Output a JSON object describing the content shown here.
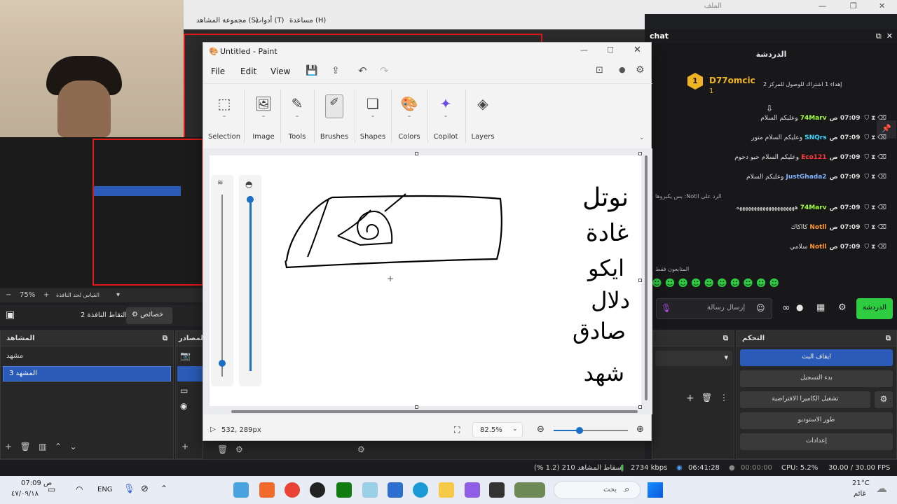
{
  "obs": {
    "window_title": "الملف",
    "menu": {
      "help": "مساعدة (H)",
      "tools": "أدوات (T)",
      "scene_collection": "مجموعة المشاهد (S)"
    },
    "zoom": "75%",
    "fit_label": "القياس لحد النافذة",
    "window_capture_label": "التقاط النافذة 2",
    "properties_label": "خصائص",
    "scenes_header": "المشاهد",
    "scenes": [
      "مشهد",
      "المشهد 3"
    ],
    "sources_header": "المصادر",
    "controls_header": "التحكم",
    "controls": [
      "ايقاف البث",
      "بدء التسجيل",
      "تشغيل الكاميرا الافتراضية",
      "طور الاستوديو",
      "إعدادات"
    ],
    "status": {
      "dropped": "إسقاط المشاهد 210 (1.2 %)",
      "kbps": "2734 kbps",
      "live_time": "06:41:28",
      "rec_time": "00:00:00",
      "cpu": "CPU: 5.2%",
      "fps": "30.00 / 30.00 FPS"
    }
  },
  "chat": {
    "panel_title": "chat",
    "tab_title": "الدردشة",
    "pinned_user": "D77omcic",
    "pinned_count": "1",
    "pinned_badge": "1",
    "pinned_text": "إهداء 1 اشتراك للوصول للمركز 2",
    "messages": [
      {
        "time": "07:09 ص",
        "user": "74Marv",
        "text": "وعليكم السلام",
        "color": "#a5ff3a"
      },
      {
        "time": "07:09 ص",
        "user": "SNQrs",
        "text": "وعليكم السلام متور",
        "color": "#39d7ff"
      },
      {
        "time": "07:09 ص",
        "user": "Eco121",
        "text": "وعليكم السلام حيو دحوم",
        "color": "#ff3a3a"
      },
      {
        "time": "07:09 ص",
        "user": "JustGhada2",
        "text": "وعليكم السلام",
        "color": "#7fb3ff"
      },
      {
        "time": "07:09 ص",
        "user": "74Marv",
        "text": "ههههههههههههههههههههه",
        "color": "#a5ff3a"
      },
      {
        "time": "07:09 ص",
        "user": "Notll",
        "text": "كااكاك",
        "color": "#ff9a2e"
      },
      {
        "time": "07:09 ص",
        "user": "Notll",
        "text": "سلامي",
        "color": "#ff9a2e"
      }
    ],
    "reply_note": "الرد على Notll: بس يكبروها",
    "subs_only": "المتابعون فقط",
    "input_placeholder": "إرسال رسالة",
    "chat_button": "الدردشة"
  },
  "paint": {
    "title": "Untitled - Paint",
    "menu": [
      "File",
      "Edit",
      "View"
    ],
    "ribbon": [
      "Selection",
      "Image",
      "Tools",
      "Brushes",
      "Shapes",
      "Colors",
      "Copilot",
      "Layers"
    ],
    "cursor_pos": "532, 289px",
    "zoom": "82.5%",
    "zoom_fraction": 0.35,
    "handwriting": [
      "نوتل",
      "غادة",
      "ايكو",
      "دلال",
      "صادق",
      "شهد"
    ]
  },
  "taskbar": {
    "time": "07:09 ص",
    "date": "٤٧/٠٩/١٨",
    "lang": "ENG",
    "search": "بحث",
    "weather_temp": "21°C",
    "weather_desc": "غائم"
  }
}
